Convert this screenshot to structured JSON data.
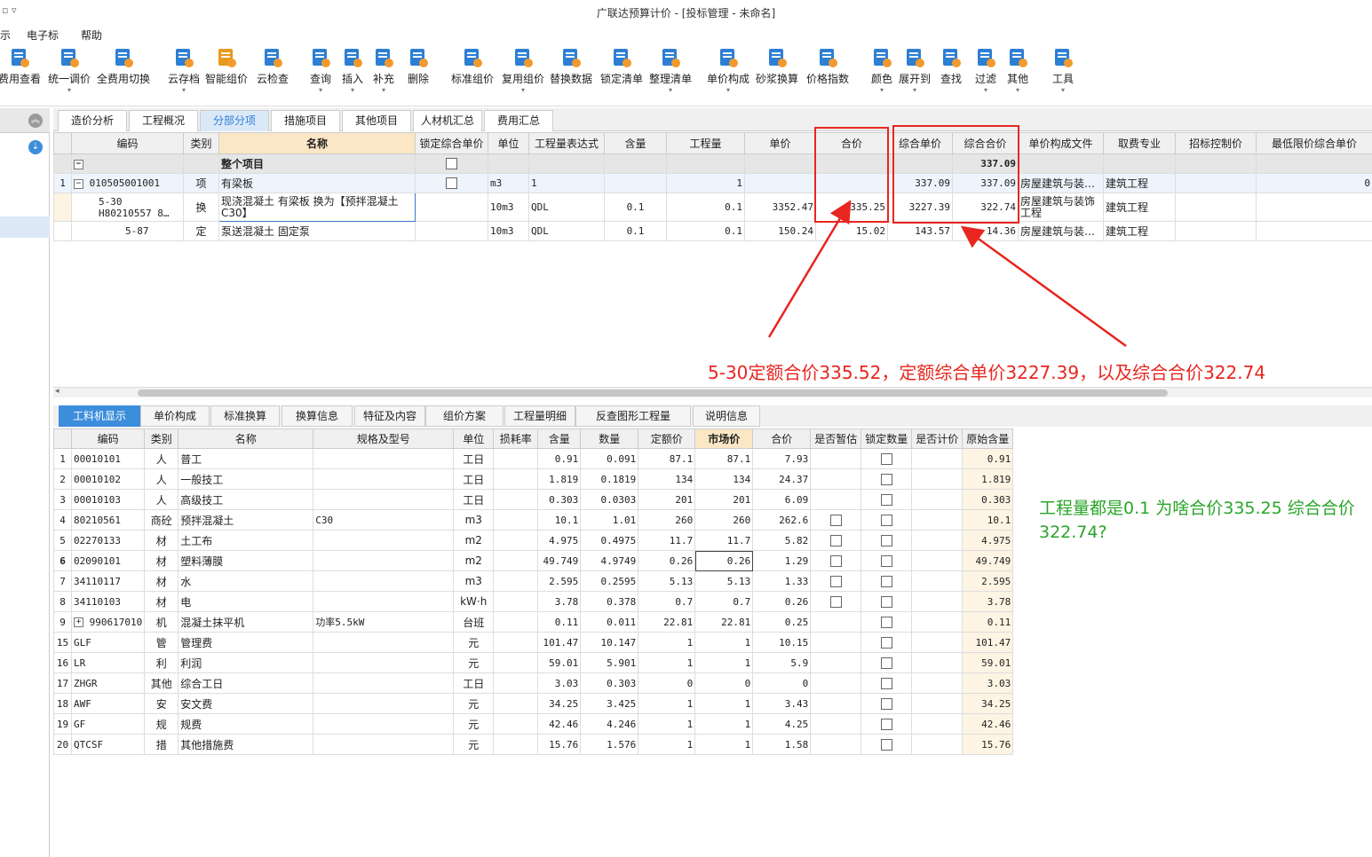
{
  "title": {
    "app": "广联达预算计价 - [投标管理 - 未命名]",
    "quick_access": "▫ ▿"
  },
  "menu": [
    "示",
    "电子标",
    "帮助"
  ],
  "toolbar": [
    {
      "label": "费用查看",
      "icon": "fee-view-icon",
      "dd": false,
      "color": "#2d7fd3"
    },
    {
      "label": "统一调价",
      "icon": "unify-price-icon",
      "dd": true,
      "color": "#2d7fd3"
    },
    {
      "label": "全费用切换",
      "icon": "full-fee-switch-icon",
      "dd": false,
      "color": "#2d7fd3"
    },
    {
      "label": "云存档",
      "icon": "cloud-archive-icon",
      "dd": true,
      "color": "#2d7fd3"
    },
    {
      "label": "智能组价",
      "icon": "smart-price-icon",
      "dd": false,
      "color": "#e89a1d"
    },
    {
      "label": "云检查",
      "icon": "cloud-check-icon",
      "dd": false,
      "color": "#2d7fd3"
    },
    {
      "label": "查询",
      "icon": "query-icon",
      "dd": true,
      "color": "#2d7fd3"
    },
    {
      "label": "插入",
      "icon": "insert-icon",
      "dd": true,
      "color": "#2d7fd3"
    },
    {
      "label": "补充",
      "icon": "supplement-icon",
      "dd": true,
      "color": "#2d7fd3"
    },
    {
      "label": "删除",
      "icon": "delete-icon",
      "dd": false,
      "color": "#2d7fd3"
    },
    {
      "label": "标准组价",
      "icon": "standard-price-icon",
      "dd": false,
      "color": "#2d7fd3"
    },
    {
      "label": "复用组价",
      "icon": "reuse-price-icon",
      "dd": true,
      "color": "#2d7fd3"
    },
    {
      "label": "替换数据",
      "icon": "replace-data-icon",
      "dd": false,
      "color": "#2d7fd3"
    },
    {
      "label": "锁定清单",
      "icon": "lock-list-icon",
      "dd": false,
      "color": "#2d7fd3"
    },
    {
      "label": "整理清单",
      "icon": "organize-list-icon",
      "dd": true,
      "color": "#2d7fd3"
    },
    {
      "label": "单价构成",
      "icon": "unit-price-compose-icon",
      "dd": true,
      "color": "#2d7fd3"
    },
    {
      "label": "砂浆换算",
      "icon": "mortar-convert-icon",
      "dd": false,
      "color": "#2d7fd3"
    },
    {
      "label": "价格指数",
      "icon": "price-index-icon",
      "dd": false,
      "color": "#2d7fd3"
    },
    {
      "label": "颜色",
      "icon": "color-icon",
      "dd": true,
      "color": "#2d7fd3"
    },
    {
      "label": "展开到",
      "icon": "expand-to-icon",
      "dd": true,
      "color": "#2d7fd3"
    },
    {
      "label": "查找",
      "icon": "find-icon",
      "dd": false,
      "color": "#2d7fd3"
    },
    {
      "label": "过滤",
      "icon": "filter-icon",
      "dd": true,
      "color": "#2d7fd3"
    },
    {
      "label": "其他",
      "icon": "other-icon",
      "dd": true,
      "color": "#2d7fd3"
    },
    {
      "label": "工具",
      "icon": "tools-icon",
      "dd": true,
      "color": "#2d7fd3"
    }
  ],
  "tabs_top": [
    "造价分析",
    "工程概况",
    "分部分项",
    "措施项目",
    "其他项目",
    "人材机汇总",
    "费用汇总"
  ],
  "tabs_top_active": 2,
  "upper_table": {
    "headers": [
      "编码",
      "类别",
      "名称",
      "锁定综合单价",
      "单位",
      "工程量表达式",
      "含量",
      "工程量",
      "单价",
      "合价",
      "综合单价",
      "综合合价",
      "单价构成文件",
      "取费专业",
      "招标控制价",
      "最低限价综合单价"
    ],
    "group_row": {
      "name": "整个项目",
      "total": "337.09"
    },
    "rows": [
      {
        "no": "1",
        "code": "010505001001",
        "type": "项",
        "name": "有梁板",
        "unit": "m3",
        "expr": "1",
        "content": "",
        "qty": "1",
        "price": "",
        "amount": "",
        "comp_price": "337.09",
        "comp_amount": "337.09",
        "file": "房屋建筑与装…",
        "major": "建筑工程",
        "ctrl": "",
        "min": "0"
      },
      {
        "no": "",
        "code": "5-30",
        "code2": "H80210557 8…",
        "type": "换",
        "name": "现浇混凝土 有梁板  换为【预拌混凝土",
        "name2": "C30】",
        "unit": "10m3",
        "expr": "QDL",
        "content": "0.1",
        "qty": "0.1",
        "price": "3352.47",
        "amount": "335.25",
        "comp_price": "3227.39",
        "comp_amount": "322.74",
        "file": "房屋建筑与装饰",
        "file2": "工程",
        "major": "建筑工程",
        "ctrl": "",
        "min": ""
      },
      {
        "no": "",
        "code": "5-87",
        "type": "定",
        "name": "泵送混凝土 固定泵",
        "unit": "10m3",
        "expr": "QDL",
        "content": "0.1",
        "qty": "0.1",
        "price": "150.24",
        "amount": "15.02",
        "comp_price": "143.57",
        "comp_amount": "14.36",
        "file": "房屋建筑与装…",
        "major": "建筑工程",
        "ctrl": "",
        "min": ""
      }
    ]
  },
  "tabs_bottom": [
    "工料机显示",
    "单价构成",
    "标准换算",
    "换算信息",
    "特征及内容",
    "组价方案",
    "工程量明细",
    "反查图形工程量",
    "说明信息"
  ],
  "tabs_bottom_active": 0,
  "lower_table": {
    "headers": [
      "",
      "编码",
      "类别",
      "名称",
      "规格及型号",
      "单位",
      "损耗率",
      "含量",
      "数量",
      "定额价",
      "市场价",
      "合价",
      "是否暂估",
      "锁定数量",
      "是否计价",
      "原始含量"
    ],
    "rows": [
      {
        "no": "1",
        "code": "00010101",
        "type": "人",
        "name": "普工",
        "spec": "",
        "unit": "工日",
        "loss": "",
        "content": "0.91",
        "qty": "0.091",
        "quota": "87.1",
        "market": "87.1",
        "amount": "7.93",
        "est": false,
        "lock": true,
        "orig": "0.91"
      },
      {
        "no": "2",
        "code": "00010102",
        "type": "人",
        "name": "一般技工",
        "spec": "",
        "unit": "工日",
        "loss": "",
        "content": "1.819",
        "qty": "0.1819",
        "quota": "134",
        "market": "134",
        "amount": "24.37",
        "est": false,
        "lock": true,
        "orig": "1.819"
      },
      {
        "no": "3",
        "code": "00010103",
        "type": "人",
        "name": "高级技工",
        "spec": "",
        "unit": "工日",
        "loss": "",
        "content": "0.303",
        "qty": "0.0303",
        "quota": "201",
        "market": "201",
        "amount": "6.09",
        "est": false,
        "lock": true,
        "orig": "0.303"
      },
      {
        "no": "4",
        "code": "80210561",
        "type": "商砼",
        "name": "预拌混凝土",
        "spec": "C30",
        "unit": "m3",
        "loss": "",
        "content": "10.1",
        "qty": "1.01",
        "quota": "260",
        "market": "260",
        "amount": "262.6",
        "est": true,
        "lock": true,
        "orig": "10.1"
      },
      {
        "no": "5",
        "code": "02270133",
        "type": "材",
        "name": "土工布",
        "spec": "",
        "unit": "m2",
        "loss": "",
        "content": "4.975",
        "qty": "0.4975",
        "quota": "11.7",
        "market": "11.7",
        "amount": "5.82",
        "est": true,
        "lock": true,
        "orig": "4.975"
      },
      {
        "no": "6",
        "code": "02090101",
        "type": "材",
        "name": "塑料薄膜",
        "spec": "",
        "unit": "m2",
        "loss": "",
        "content": "49.749",
        "qty": "4.9749",
        "quota": "0.26",
        "market": "0.26",
        "amount": "1.29",
        "est": true,
        "lock": true,
        "orig": "49.749",
        "current": true
      },
      {
        "no": "7",
        "code": "34110117",
        "type": "材",
        "name": "水",
        "spec": "",
        "unit": "m3",
        "loss": "",
        "content": "2.595",
        "qty": "0.2595",
        "quota": "5.13",
        "market": "5.13",
        "amount": "1.33",
        "est": true,
        "lock": true,
        "orig": "2.595"
      },
      {
        "no": "8",
        "code": "34110103",
        "type": "材",
        "name": "电",
        "spec": "",
        "unit": "kW·h",
        "loss": "",
        "content": "3.78",
        "qty": "0.378",
        "quota": "0.7",
        "market": "0.7",
        "amount": "0.26",
        "est": true,
        "lock": true,
        "orig": "3.78"
      },
      {
        "no": "9",
        "code": "990617010",
        "type": "机",
        "name": "混凝土抹平机",
        "spec": "功率5.5kW",
        "unit": "台班",
        "loss": "",
        "content": "0.11",
        "qty": "0.011",
        "quota": "22.81",
        "market": "22.81",
        "amount": "0.25",
        "est": false,
        "lock": true,
        "orig": "0.11",
        "tree": true
      },
      {
        "no": "15",
        "code": "GLF",
        "type": "管",
        "name": "管理费",
        "spec": "",
        "unit": "元",
        "loss": "",
        "content": "101.47",
        "qty": "10.147",
        "quota": "1",
        "market": "1",
        "amount": "10.15",
        "est": false,
        "lock": true,
        "orig": "101.47"
      },
      {
        "no": "16",
        "code": "LR",
        "type": "利",
        "name": "利润",
        "spec": "",
        "unit": "元",
        "loss": "",
        "content": "59.01",
        "qty": "5.901",
        "quota": "1",
        "market": "1",
        "amount": "5.9",
        "est": false,
        "lock": true,
        "orig": "59.01"
      },
      {
        "no": "17",
        "code": "ZHGR",
        "type": "其他",
        "name": "综合工日",
        "spec": "",
        "unit": "工日",
        "loss": "",
        "content": "3.03",
        "qty": "0.303",
        "quota": "0",
        "market": "0",
        "amount": "0",
        "est": false,
        "lock": true,
        "orig": "3.03"
      },
      {
        "no": "18",
        "code": "AWF",
        "type": "安",
        "name": "安文费",
        "spec": "",
        "unit": "元",
        "loss": "",
        "content": "34.25",
        "qty": "3.425",
        "quota": "1",
        "market": "1",
        "amount": "3.43",
        "est": false,
        "lock": true,
        "orig": "34.25"
      },
      {
        "no": "19",
        "code": "GF",
        "type": "规",
        "name": "规费",
        "spec": "",
        "unit": "元",
        "loss": "",
        "content": "42.46",
        "qty": "4.246",
        "quota": "1",
        "market": "1",
        "amount": "4.25",
        "est": false,
        "lock": true,
        "orig": "42.46"
      },
      {
        "no": "20",
        "code": "QTCSF",
        "type": "措",
        "name": "其他措施费",
        "spec": "",
        "unit": "元",
        "loss": "",
        "content": "15.76",
        "qty": "1.576",
        "quota": "1",
        "market": "1",
        "amount": "1.58",
        "est": false,
        "lock": true,
        "orig": "15.76"
      }
    ]
  },
  "annotations": {
    "red": "5-30定额合价335.52，定额综合单价3227.39，以及综合合价322.74",
    "green": "工程量都是0.1 为啥合价335.25 综合合价322.74?"
  },
  "colors": {
    "accent": "#2e7fd8",
    "annot_red": "#e8261f",
    "annot_green": "#2aa52a"
  }
}
